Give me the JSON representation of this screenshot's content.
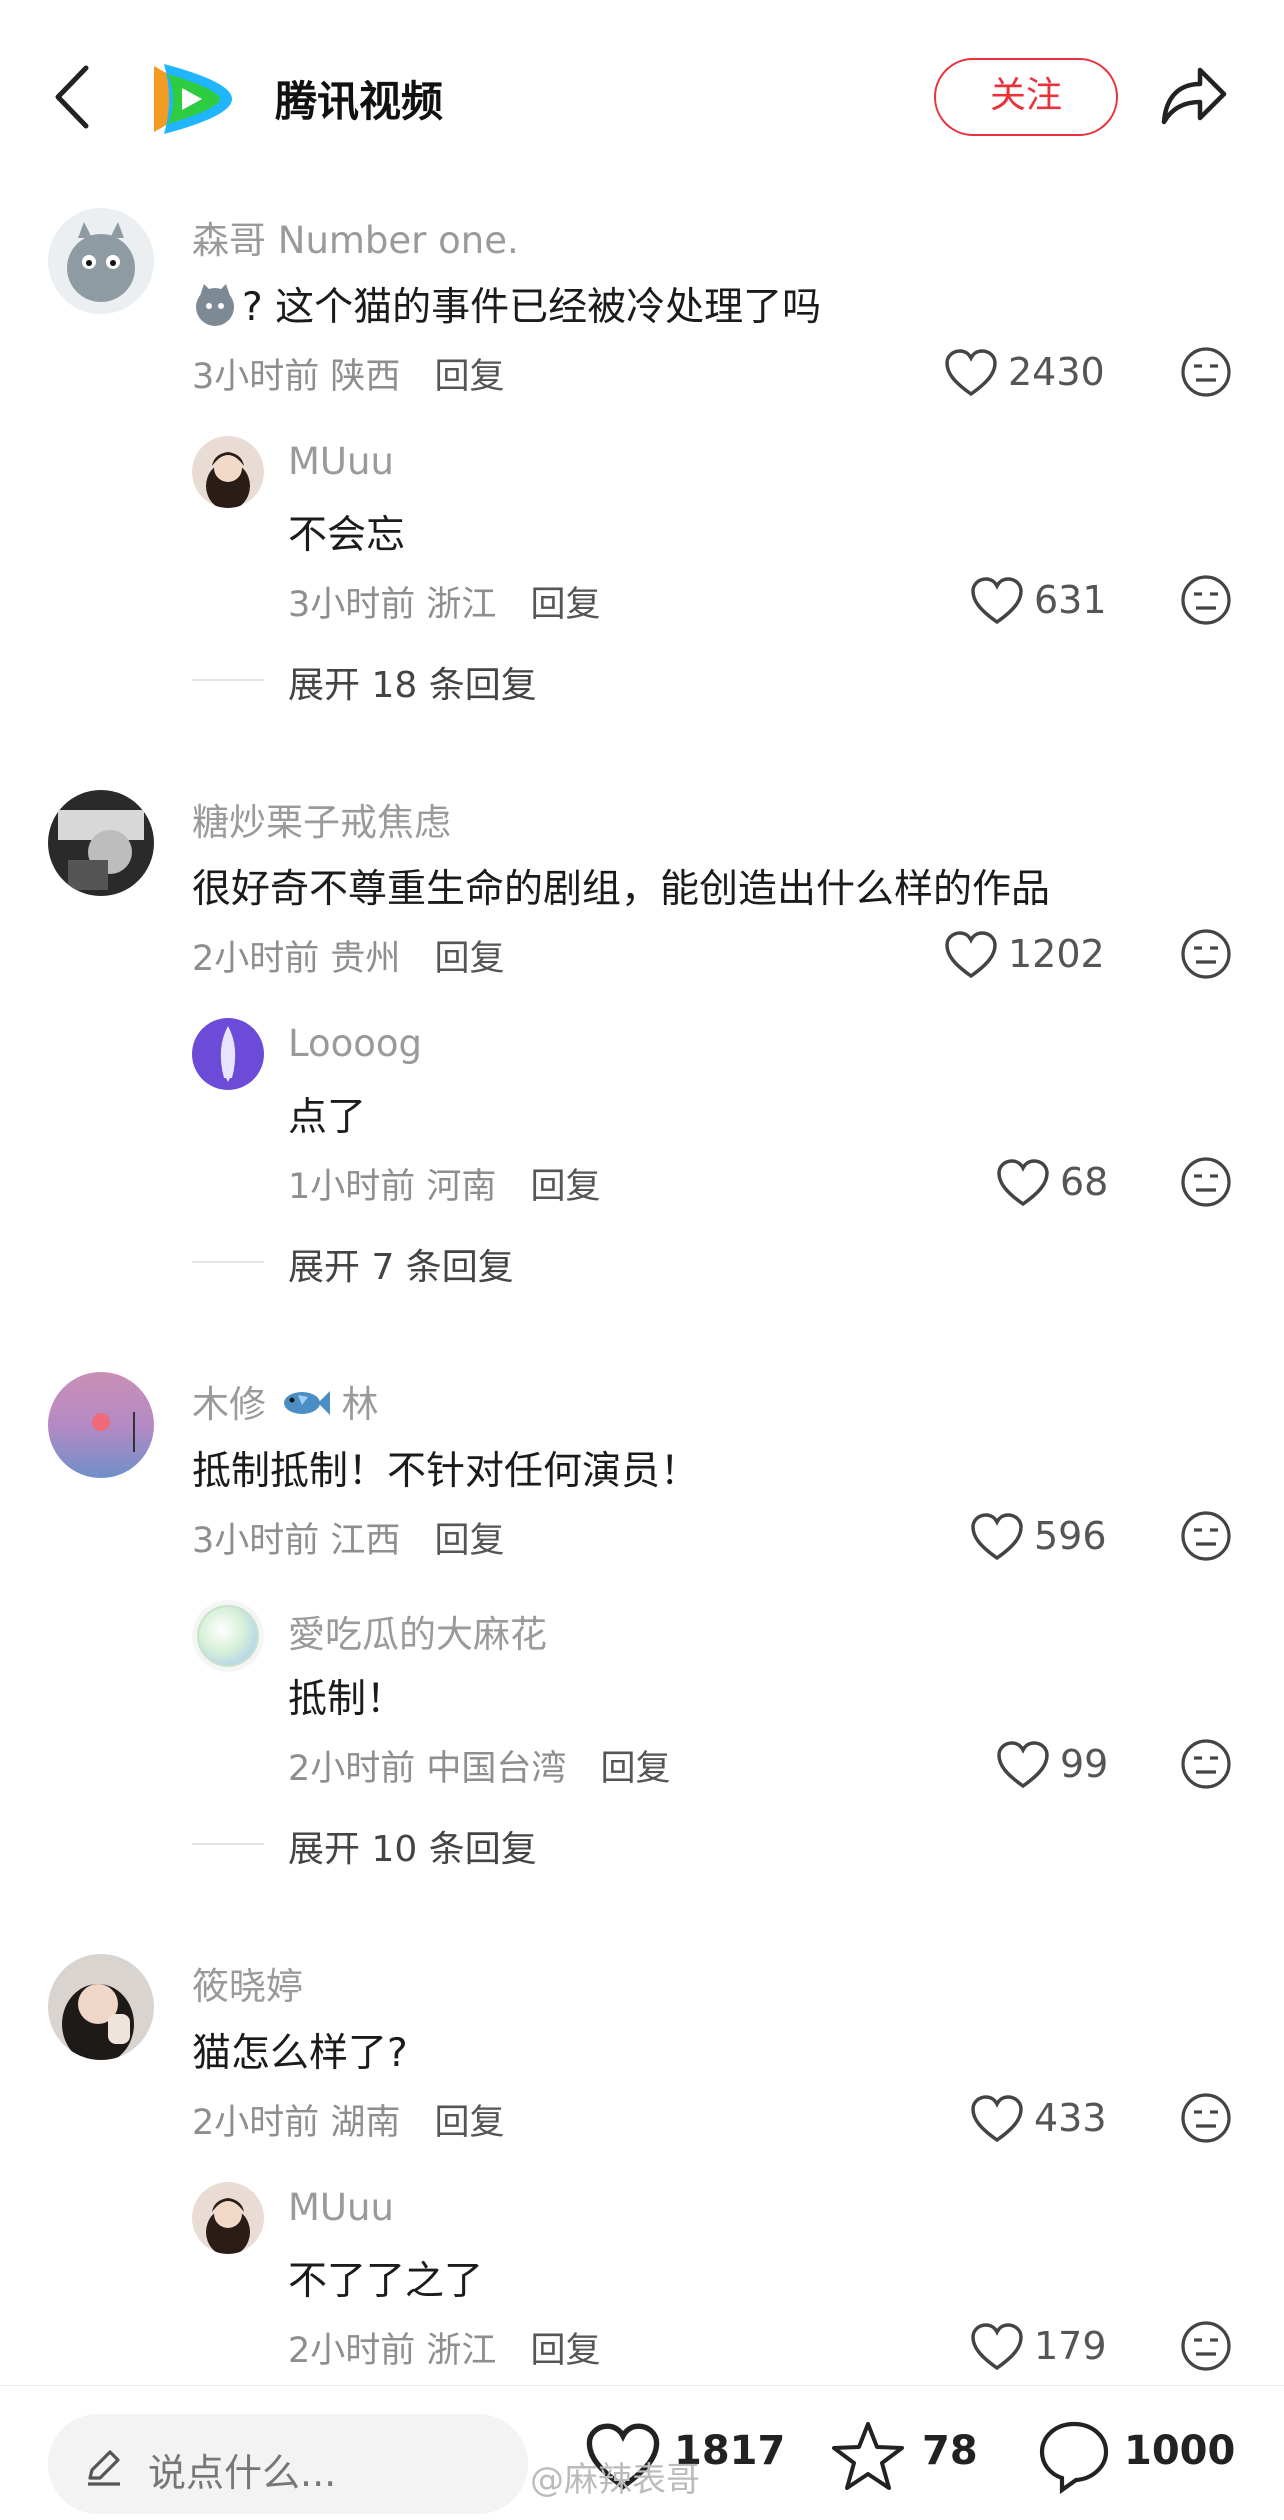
{
  "header": {
    "app_name": "腾讯视频",
    "follow_label": "关注"
  },
  "comments": [
    {
      "user": "森哥 Number one.",
      "text": "? 这个猫的事件已经被冷处理了吗",
      "time": "3小时前",
      "location": "陕西",
      "reply": "回复",
      "likes": "2430",
      "sub": {
        "user": "MUuu",
        "text": "不会忘",
        "time": "3小时前",
        "location": "浙江",
        "reply": "回复",
        "likes": "631"
      },
      "expand": "展开 18 条回复"
    },
    {
      "user": "糖炒栗子戒焦虑",
      "text": "很好奇不尊重生命的剧组，能创造出什么样的作品",
      "time": "2小时前",
      "location": "贵州",
      "reply": "回复",
      "likes": "1202",
      "sub": {
        "user": "Loooog",
        "text": "点了",
        "time": "1小时前",
        "location": "河南",
        "reply": "回复",
        "likes": "68"
      },
      "expand": "展开 7 条回复"
    },
    {
      "user_pre": "木修",
      "user_post": "林",
      "text": "抵制抵制！不针对任何演员！",
      "time": "3小时前",
      "location": "江西",
      "reply": "回复",
      "likes": "596",
      "sub": {
        "user": "愛吃瓜的大麻花",
        "text": "抵制！",
        "time": "2小时前",
        "location": "中国台湾",
        "reply": "回复",
        "likes": "99"
      },
      "expand": "展开 10 条回复"
    },
    {
      "user": "筱晓婷",
      "text": "猫怎么样了?",
      "time": "2小时前",
      "location": "湖南",
      "reply": "回复",
      "likes": "433",
      "sub": {
        "user": "MUuu",
        "text": "不了了之了",
        "time": "2小时前",
        "location": "浙江",
        "reply": "回复",
        "likes": "179"
      }
    }
  ],
  "bottom": {
    "placeholder": "说点什么...",
    "likes": "1817",
    "favorites": "78",
    "comments": "1000"
  },
  "watermark": "@麻辣表哥",
  "colors": {
    "accent": "#e8333c",
    "meta": "#8e8e8e",
    "username": "#9a9a9a"
  }
}
